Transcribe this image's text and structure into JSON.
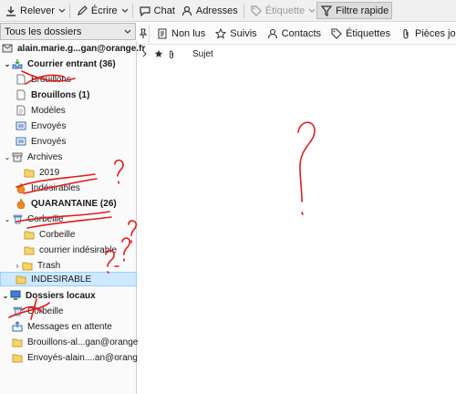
{
  "toolbar": {
    "receive_label": "Relever",
    "write_label": "Écrire",
    "chat_label": "Chat",
    "contacts_label": "Adresses",
    "tag_label": "Étiquette",
    "quickfilter_label": "Filtre rapide"
  },
  "folder_pane": {
    "header_label": "Tous les dossiers",
    "account_label": "alain.marie.g...gan@orange.fr",
    "folders": [
      {
        "label": "Courrier entrant (36)"
      },
      {
        "label": "Brouillons"
      },
      {
        "label": "Brouillons (1)"
      },
      {
        "label": "Modèles"
      },
      {
        "label": "Envoyés"
      },
      {
        "label": "Envoyés"
      },
      {
        "label": "Archives"
      },
      {
        "label": "2019"
      },
      {
        "label": "Indésirables"
      },
      {
        "label": "QUARANTAINE (26)"
      },
      {
        "label": "Corbeille"
      },
      {
        "label": "Corbeille"
      },
      {
        "label": "courrier indésirable"
      },
      {
        "label": "Trash"
      },
      {
        "label": "INDESIRABLE"
      }
    ],
    "local_label": "Dossiers locaux",
    "local_folders": [
      {
        "label": "Corbeille"
      },
      {
        "label": "Messages en attente"
      },
      {
        "label": "Brouillons-al...gan@orange.fr"
      },
      {
        "label": "Envoyés-alain....an@orange.fr"
      }
    ]
  },
  "quick_filter": {
    "unread_label": "Non lus",
    "starred_label": "Suivis",
    "contacts_label": "Contacts",
    "tags_label": "Étiquettes",
    "attachments_label": "Pièces jointes"
  },
  "message_list": {
    "subject_header": "Sujet"
  },
  "colors": {
    "accent": "#1f6fcf",
    "annotation": "#e31b1b",
    "folder_yellow": "#f6d36b",
    "selected_bg": "#cde8ff"
  }
}
